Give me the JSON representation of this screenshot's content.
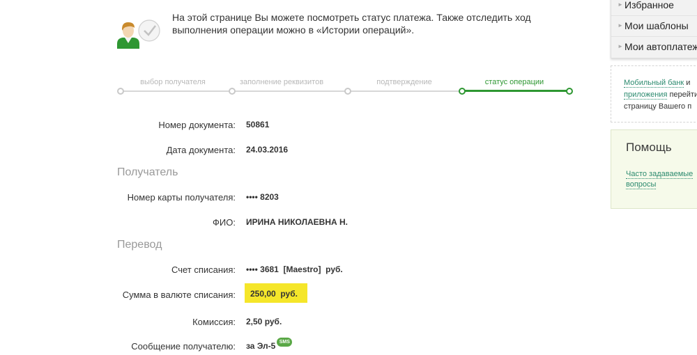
{
  "info": {
    "text": "На этой странице Вы можете посмотреть статус платежа. Также отследить ход выполнения операции можно в «Истории операций»."
  },
  "steps": [
    {
      "label": "выбор получателя",
      "active": false
    },
    {
      "label": "заполнение реквизитов",
      "active": false
    },
    {
      "label": "подтверждение",
      "active": false
    },
    {
      "label": "статус операции",
      "active": true
    }
  ],
  "details": {
    "doc_number_label": "Номер документа:",
    "doc_number": "50861",
    "doc_date_label": "Дата документа:",
    "doc_date": "24.03.2016",
    "recipient_section": "Получатель",
    "card_label": "Номер карты получателя:",
    "card_value": "•••• 8203",
    "fio_label": "ФИО:",
    "fio_value": "ИРИНА НИКОЛАЕВНА Н.",
    "transfer_section": "Перевод",
    "account_label": "Счет списания:",
    "account_value": "•••• 3681  [Maestro]  руб.",
    "amount_label": "Сумма в валюте списания:",
    "amount_value": "250,00  руб.",
    "commission_label": "Комиссия:",
    "commission_value": "2,50 руб.",
    "message_label": "Сообщение получателю:",
    "message_value": "за Эл-5",
    "sms_badge": "SMS"
  },
  "menu": {
    "items": [
      "Избранное",
      "Мои шаблоны",
      "Мои автоплатежи"
    ]
  },
  "promo": {
    "line1_link": "Мобильный банк",
    "line1_rest": " и",
    "line2_link": "приложения",
    "line2_rest": " перейти",
    "line3": "страницу Вашего п"
  },
  "help": {
    "title": "Помощь",
    "faq_link": "Часто задаваемые вопросы"
  },
  "colors": {
    "accent_green": "#2e9732",
    "highlight_yellow": "#f5e62a",
    "link_teal": "#2b8a6e"
  }
}
